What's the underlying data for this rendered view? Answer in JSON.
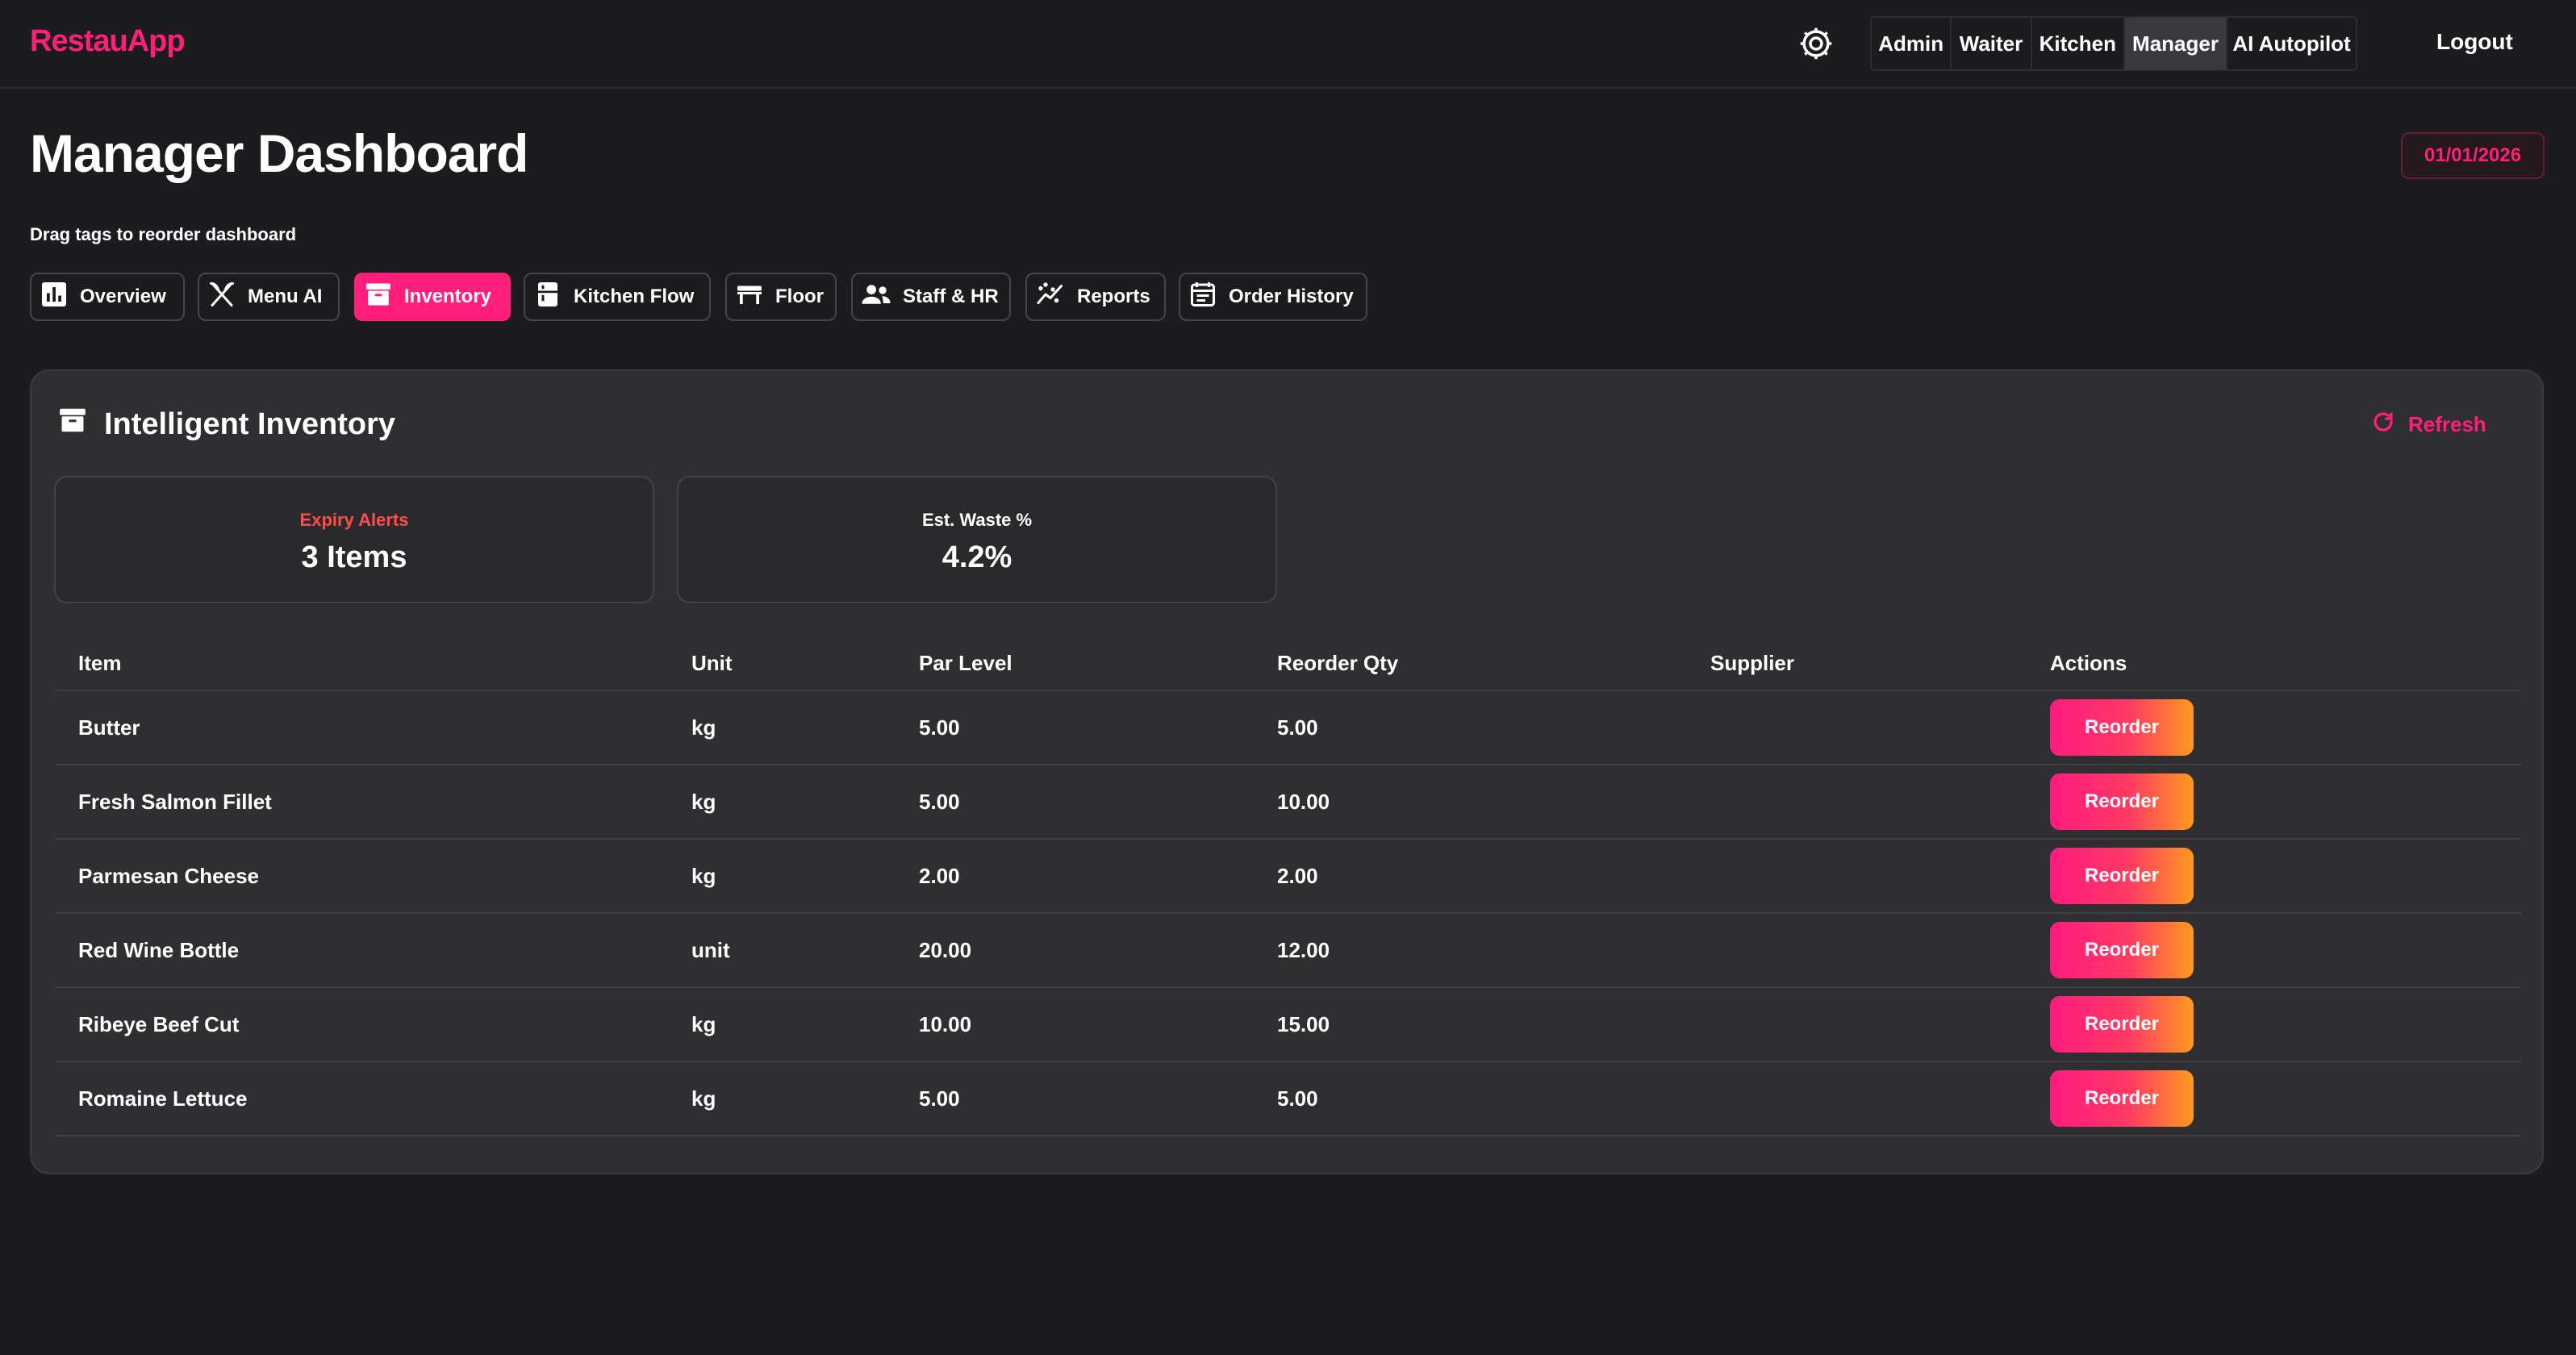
{
  "app": {
    "brand": "RestauApp"
  },
  "topbar": {
    "roles": [
      {
        "label": "Admin",
        "active": false
      },
      {
        "label": "Waiter",
        "active": false
      },
      {
        "label": "Kitchen",
        "active": false
      },
      {
        "label": "Manager",
        "active": true
      },
      {
        "label": "AI Autopilot",
        "active": false
      }
    ],
    "logout_label": "Logout",
    "theme_icon": "sun-icon"
  },
  "header": {
    "title": "Manager Dashboard",
    "date": "01/01/2026",
    "hint": "Drag tags to reorder dashboard"
  },
  "tags": [
    {
      "label": "Overview",
      "icon": "bar-chart-icon",
      "active": false
    },
    {
      "label": "Menu AI",
      "icon": "utensils-icon",
      "active": false
    },
    {
      "label": "Inventory",
      "icon": "archive-box-icon",
      "active": true
    },
    {
      "label": "Kitchen Flow",
      "icon": "kitchen-icon",
      "active": false
    },
    {
      "label": "Floor",
      "icon": "table-icon",
      "active": false
    },
    {
      "label": "Staff & HR",
      "icon": "people-icon",
      "active": false
    },
    {
      "label": "Reports",
      "icon": "trend-line-icon",
      "active": false
    },
    {
      "label": "Order History",
      "icon": "calendar-list-icon",
      "active": false
    }
  ],
  "panel": {
    "title": "Intelligent Inventory",
    "title_icon": "archive-box-icon",
    "refresh_label": "Refresh",
    "stats": [
      {
        "label": "Expiry Alerts",
        "value": "3 Items",
        "label_color": "#ff4d4d"
      },
      {
        "label": "Est. Waste %",
        "value": "4.2%",
        "label_color": "#ffffff"
      }
    ]
  },
  "table": {
    "columns": [
      "Item",
      "Unit",
      "Par Level",
      "Reorder Qty",
      "Supplier",
      "Actions"
    ],
    "action_label": "Reorder",
    "rows": [
      {
        "item": "Butter",
        "unit": "kg",
        "par": "5.00",
        "reorder": "5.00",
        "supplier": ""
      },
      {
        "item": "Fresh Salmon Fillet",
        "unit": "kg",
        "par": "5.00",
        "reorder": "10.00",
        "supplier": ""
      },
      {
        "item": "Parmesan Cheese",
        "unit": "kg",
        "par": "2.00",
        "reorder": "2.00",
        "supplier": ""
      },
      {
        "item": "Red Wine Bottle",
        "unit": "unit",
        "par": "20.00",
        "reorder": "12.00",
        "supplier": ""
      },
      {
        "item": "Ribeye Beef Cut",
        "unit": "kg",
        "par": "10.00",
        "reorder": "15.00",
        "supplier": ""
      },
      {
        "item": "Romaine Lettuce",
        "unit": "kg",
        "par": "5.00",
        "reorder": "5.00",
        "supplier": ""
      }
    ]
  },
  "colors": {
    "accent": "#ff1f7a",
    "background": "#1c1c1e",
    "panel": "#2f2f31",
    "alert": "#ff4d4d"
  }
}
